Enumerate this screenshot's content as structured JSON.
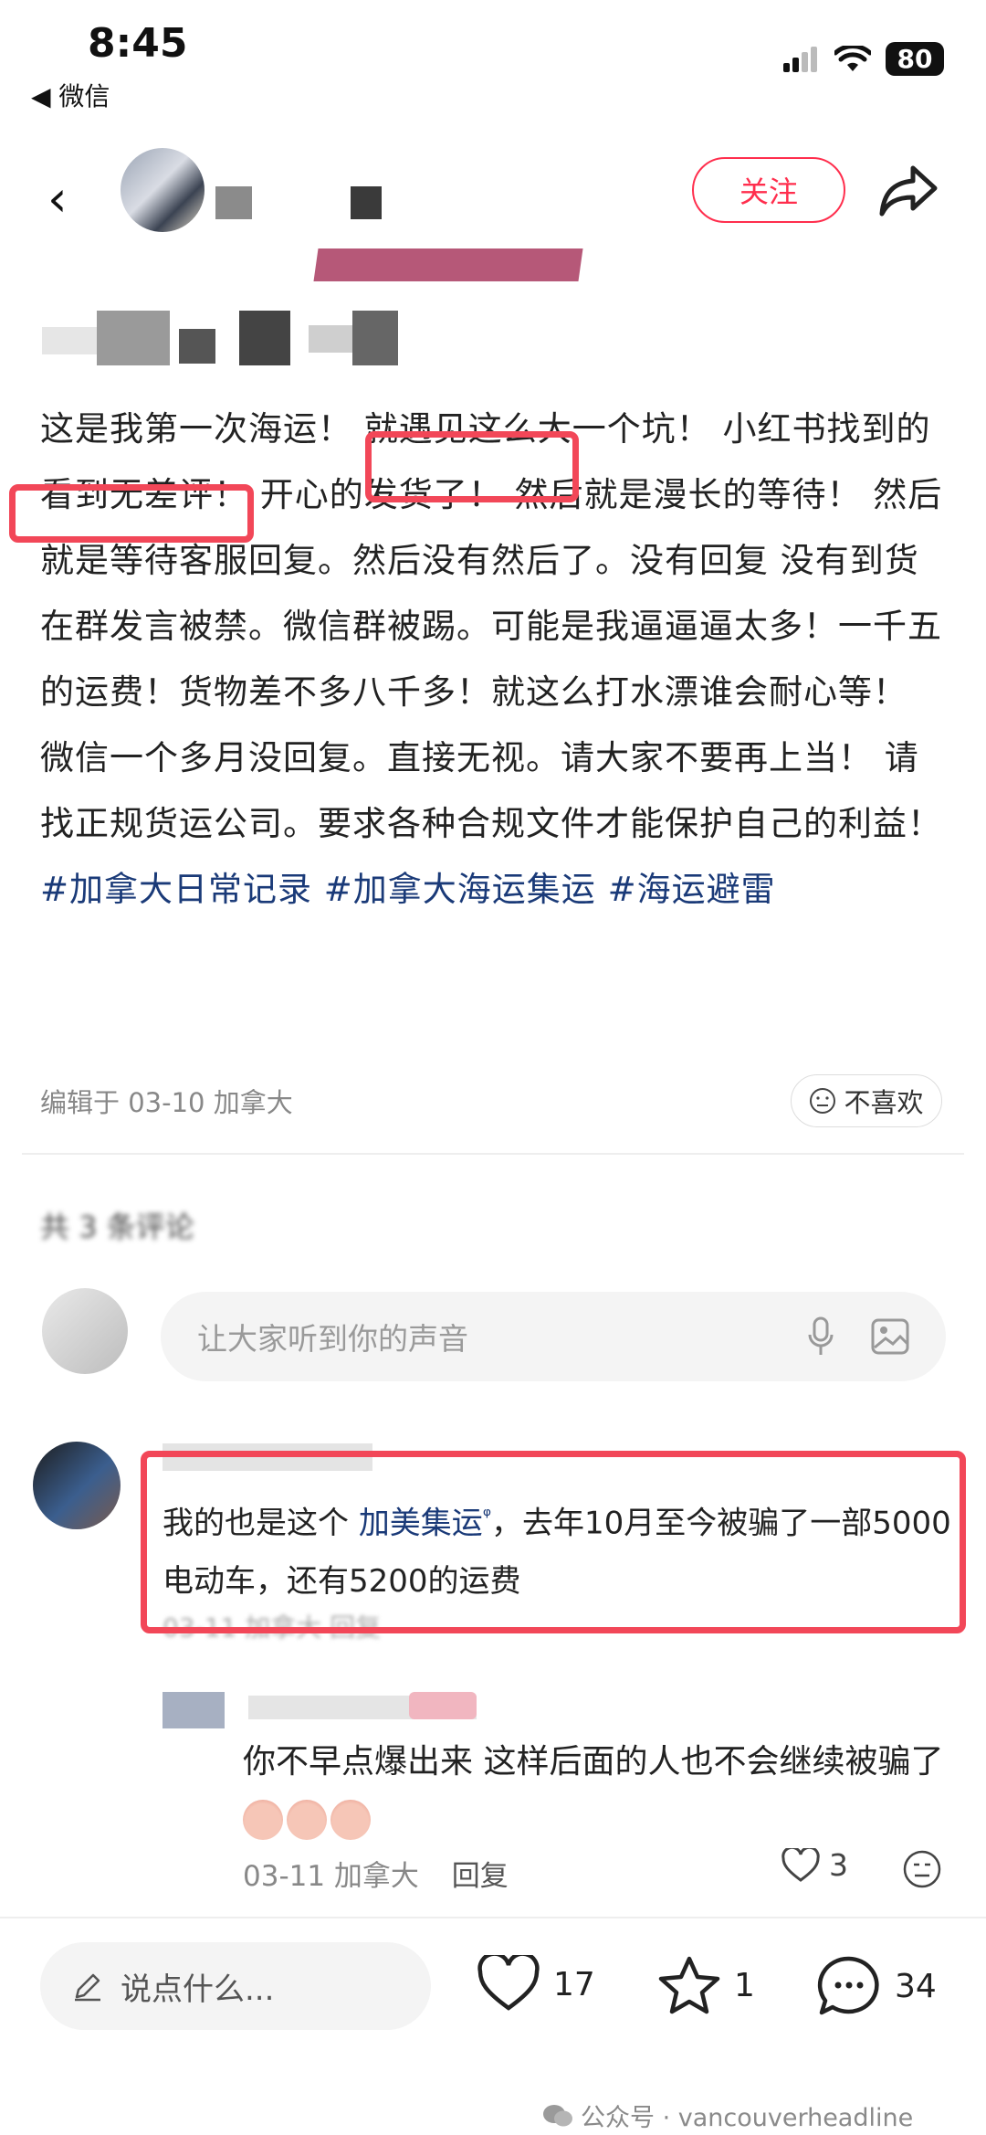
{
  "status_bar": {
    "time": "8:45",
    "back_app": "◀ 微信",
    "battery": "80"
  },
  "header": {
    "follow_label": "关注"
  },
  "post": {
    "body_plain": "这是我第一次海运！ 就遇见这么大一个坑！ 小红书找到的 看到无差评！ 开心的发货了！ 然后就是漫长的等待！ 然后就是等待客服回复。然后没有然后了。没有回复 没有到货  在群发言被禁。微信群被踢。可能是我逼逼逼太多！",
    "highlight_1": "一千五的运费！",
    "text_mid_1": "货",
    "highlight_2": "物差不多八千多！",
    "text_mid_2": "就这么打水漂谁会耐心等！ 微信一个多月没回复。直接无视。请大家不要再上当！ 请找正规货运公司。要求各种合规文件才能保护自己的利益！",
    "tags": [
      "#加拿大日常记录",
      "#加拿大海运集运",
      "#海运避雷"
    ],
    "meta": "编辑于 03-10 加拿大",
    "dislike_label": "不喜欢"
  },
  "comments_header": "共 3 条评论",
  "comment_input_placeholder": "让大家听到你的声音",
  "comments": [
    {
      "text_before": "我的也是这个",
      "link": "加美集运",
      "text_after": "，去年10月至今被骗了一部5000电动车，还有5200的运费",
      "meta": "03-11 加拿大 回复"
    }
  ],
  "reply": {
    "text": "你不早点爆出来 这样后面的人也不会继续被骗了",
    "date_loc": "03-11 加拿大",
    "reply_label": "回复",
    "likes": "3"
  },
  "bottom_bar": {
    "say_placeholder": "说点什么...",
    "likes": "17",
    "favorites": "1",
    "comments": "34"
  },
  "watermark": "公众号 · vancouverheadline",
  "colors": {
    "accent": "#ff2e4d",
    "highlight_box": "#f24758",
    "tag": "#1a3a78"
  }
}
